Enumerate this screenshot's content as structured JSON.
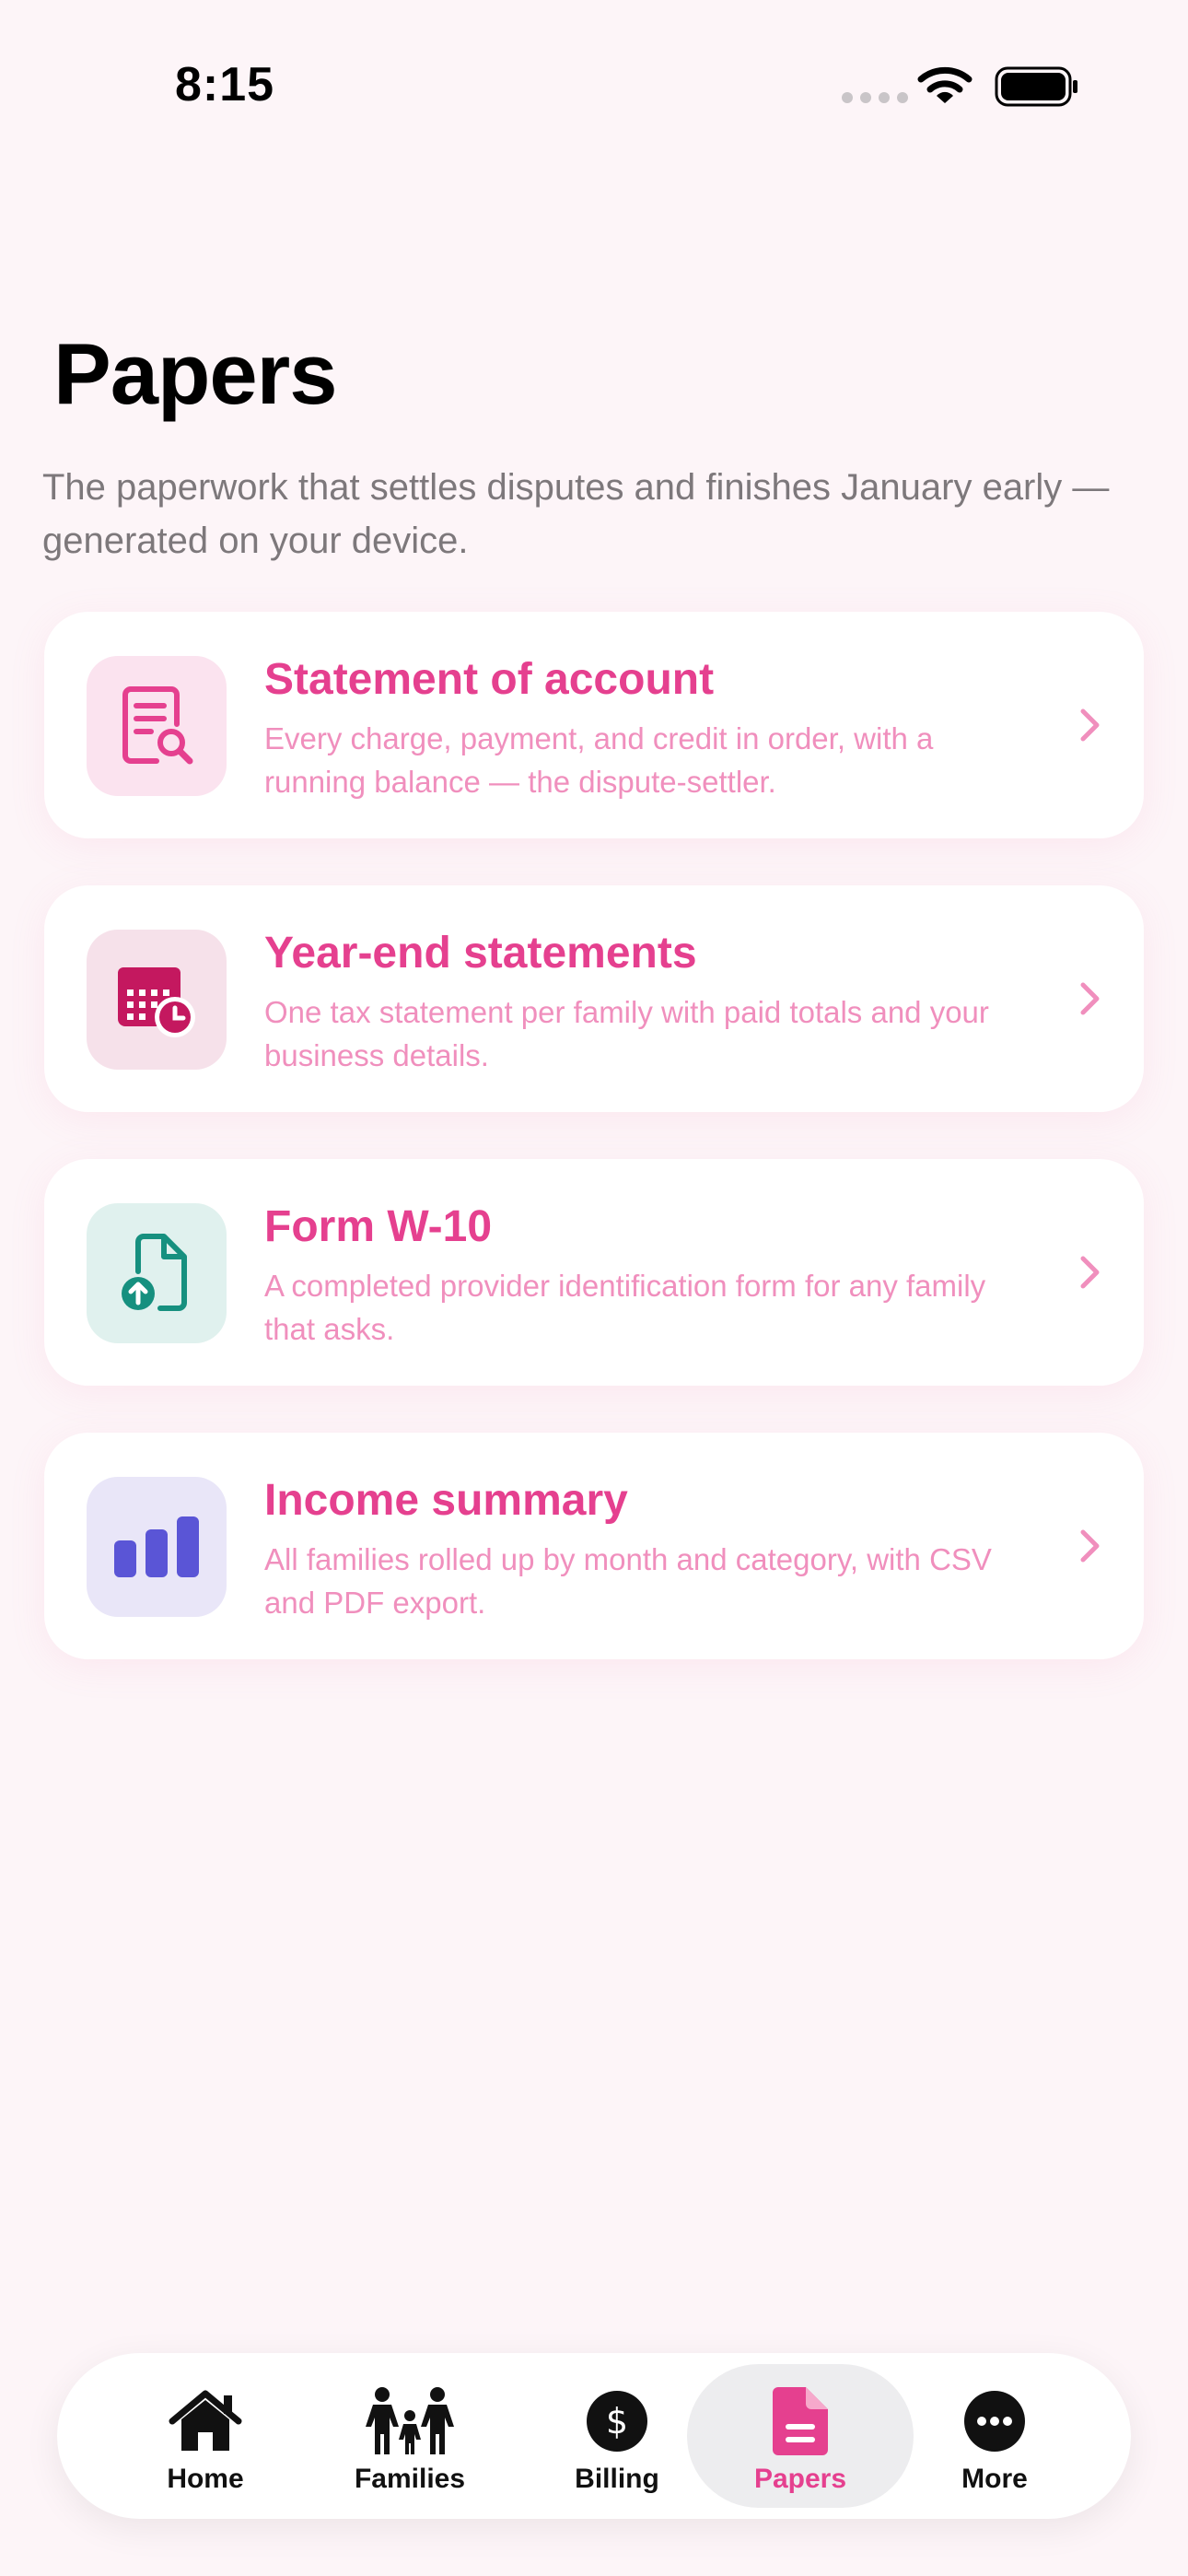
{
  "status_bar": {
    "time": "8:15"
  },
  "header": {
    "title": "Papers",
    "subtitle": "The paperwork that settles disputes and finishes January early — generated on your device."
  },
  "cards": [
    {
      "title": "Statement of account",
      "description": "Every charge, payment, and credit in order, with a running balance — the dispute-settler.",
      "icon": "document-search-icon",
      "icon_bg": "#fbe3ef",
      "icon_color": "#e5408f"
    },
    {
      "title": "Year-end statements",
      "description": "One tax statement per family with paid totals and your business details.",
      "icon": "calendar-clock-icon",
      "icon_bg": "#f6e1ea",
      "icon_color": "#c4185f"
    },
    {
      "title": "Form W-10",
      "description": "A completed provider identification form for any family that asks.",
      "icon": "file-upload-icon",
      "icon_bg": "#e0f1ee",
      "icon_color": "#16907f"
    },
    {
      "title": "Income summary",
      "description": "All families rolled up by month and category, with CSV and PDF export.",
      "icon": "bar-chart-icon",
      "icon_bg": "#e9e6f8",
      "icon_color": "#5a55d6"
    }
  ],
  "tab_bar": {
    "active": "Papers",
    "items": [
      {
        "label": "Home",
        "icon": "home-icon"
      },
      {
        "label": "Families",
        "icon": "family-icon"
      },
      {
        "label": "Billing",
        "icon": "dollar-icon"
      },
      {
        "label": "Papers",
        "icon": "document-icon"
      },
      {
        "label": "More",
        "icon": "more-icon"
      }
    ]
  },
  "colors": {
    "accent": "#e5408f",
    "background": "#fdf5f8",
    "subtitle": "#7d787b"
  }
}
